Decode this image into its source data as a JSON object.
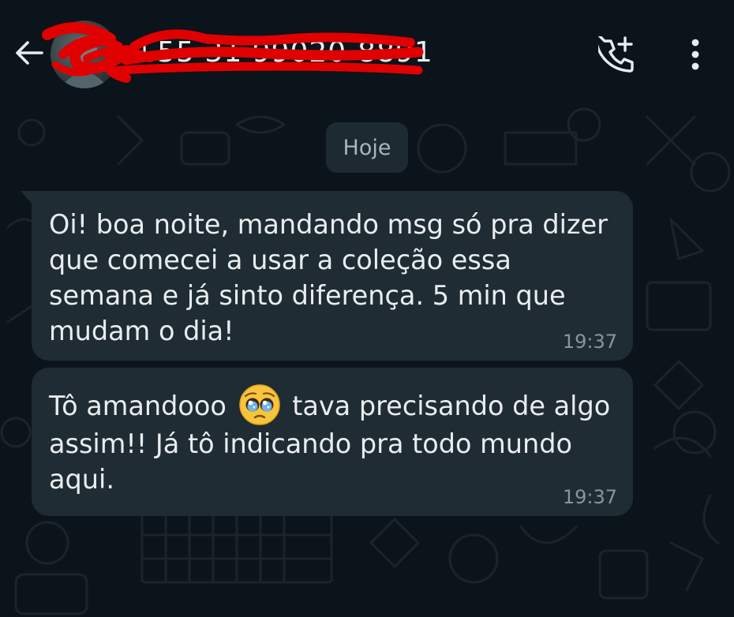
{
  "header": {
    "contact_name": "+55 31 99020-8891",
    "back_icon": "arrow-left-icon",
    "call_icon": "phone-add-icon",
    "menu_icon": "more-vertical-icon"
  },
  "chat": {
    "date_label": "Hoje",
    "messages": [
      {
        "text": "Oi! boa noite, mandando msg só pra dizer que comecei a usar a coleção essa semana e já sinto diferença. 5 min que mudam o dia!",
        "time": "19:37"
      },
      {
        "text_before_emoji": "Tô amandooo",
        "emoji": "pleading-face-emoji",
        "text_after_emoji": "tava precisando de algo assim!! Já tô indicando pra todo mundo aqui.",
        "time": "19:37"
      }
    ]
  },
  "colors": {
    "background": "#0b141a",
    "bubble": "#1f2c33",
    "text": "#e9edef",
    "timestamp": "#8696a0",
    "redaction": "#e00000"
  }
}
